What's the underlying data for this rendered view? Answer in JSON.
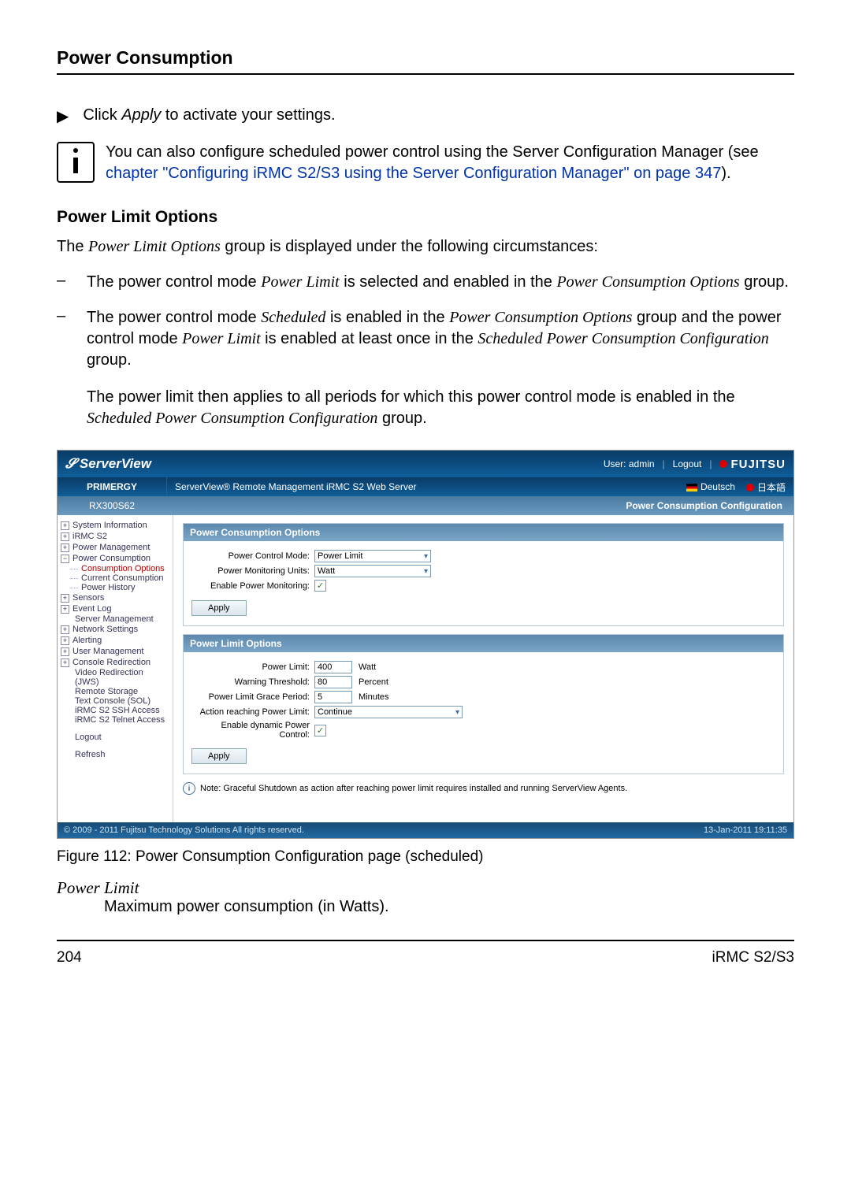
{
  "header_title": "Power Consumption",
  "line1_pre": "Click ",
  "line1_em": "Apply",
  "line1_post": " to activate your settings.",
  "info_pre": "You can also configure scheduled power control using the Server Configuration Manager (see ",
  "info_link": "chapter \"Configuring iRMC S2/S3 using the Server Configuration Manager\" on page 347",
  "info_post": ").",
  "plo_title": "Power Limit Options",
  "plo_intro_pre": "The ",
  "plo_intro_em": "Power Limit Options",
  "plo_intro_post": " group is displayed under the following circumstances:",
  "d1_a": "The power control mode  ",
  "d1_b": "Power Limit",
  "d1_c": " is selected and enabled in the ",
  "d1_d": "Power Consumption Options",
  "d1_e": " group.",
  "d2_a": "The power control mode ",
  "d2_b": "Scheduled",
  "d2_c": " is enabled in the ",
  "d2_d": "Power Consumption Options",
  "d2_e": " group and the power control mode ",
  "d2_f": "Power Limit",
  "d2_g": " is enabled at least once in the ",
  "d2_h": "Scheduled Power Consumption Configuration",
  "d2_i": " group.",
  "d2_p2a": "The power limit then applies to all periods for which this power control mode is enabled in the ",
  "d2_p2b": "Scheduled Power Consumption Configuration",
  "d2_p2c": " group.",
  "sv": {
    "brand": "ServerView",
    "user_label": "User: admin",
    "logout": "Logout",
    "fujitsu": "FUJITSU",
    "primergy": "PRIMERGY",
    "subtitle": "ServerView® Remote Management iRMC S2 Web Server",
    "lang_de": "Deutsch",
    "lang_jp": "日本語",
    "model": "RX300S62",
    "page_title": "Power Consumption Configuration",
    "tree": {
      "sysinfo": "System Information",
      "irmc": "iRMC S2",
      "pm": "Power Management",
      "pc": "Power Consumption",
      "pc_opts": "Consumption Options",
      "pc_cur": "Current Consumption",
      "pc_hist": "Power History",
      "sensors": "Sensors",
      "evlog": "Event Log",
      "srvmgmt": "Server Management",
      "net": "Network Settings",
      "alert": "Alerting",
      "usermgmt": "User Management",
      "console": "Console Redirection",
      "video": "Video Redirection (JWS)",
      "remote": "Remote Storage",
      "textcon": "Text Console (SOL)",
      "ssh": "iRMC S2 SSH Access",
      "telnet": "iRMC S2 Telnet Access",
      "logout": "Logout",
      "refresh": "Refresh"
    },
    "p1": {
      "title": "Power Consumption Options",
      "l_mode": "Power Control Mode:",
      "v_mode": "Power Limit",
      "l_units": "Power Monitoring Units:",
      "v_units": "Watt",
      "l_en": "Enable Power Monitoring:",
      "apply": "Apply"
    },
    "p2": {
      "title": "Power Limit Options",
      "l_limit": "Power Limit:",
      "v_limit": "400",
      "u_limit": "Watt",
      "l_warn": "Warning Threshold:",
      "v_warn": "80",
      "u_warn": "Percent",
      "l_grace": "Power Limit Grace Period:",
      "v_grace": "5",
      "u_grace": "Minutes",
      "l_action": "Action reaching Power Limit:",
      "v_action": "Continue",
      "l_dyn": "Enable dynamic Power Control:",
      "apply": "Apply"
    },
    "note": "Note: Graceful Shutdown as action after reaching power limit requires installed and running ServerView Agents.",
    "footer_left": "© 2009 - 2011 Fujitsu Technology Solutions All rights reserved.",
    "footer_right": "13-Jan-2011 19:11:35"
  },
  "caption": "Figure 112: Power Consumption Configuration page (scheduled)",
  "def_term": "Power Limit",
  "def_body": "Maximum power consumption (in Watts).",
  "page_num": "204",
  "doc_id": "iRMC S2/S3"
}
